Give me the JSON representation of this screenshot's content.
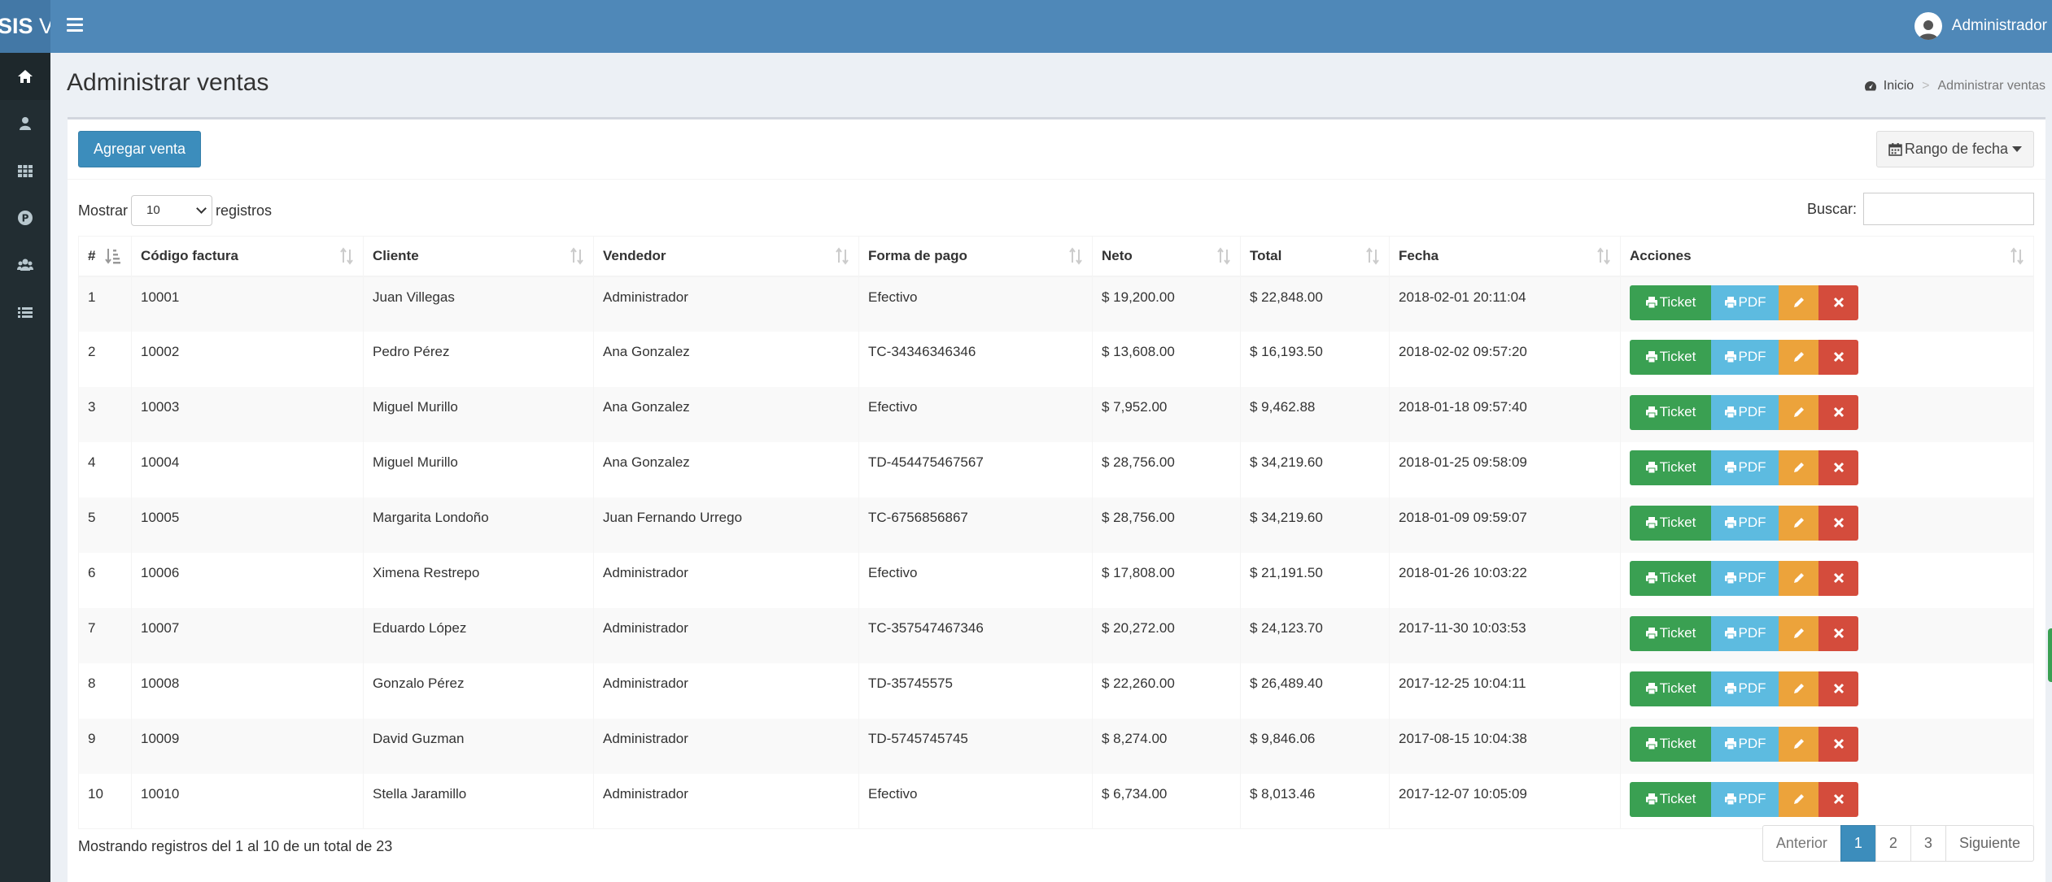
{
  "header": {
    "logo_bold": "SIS",
    "logo_light": " V",
    "user_name": "Administrador"
  },
  "sidebar": {
    "items": [
      {
        "icon": "home-icon",
        "active": true
      },
      {
        "icon": "user-icon",
        "active": false
      },
      {
        "icon": "grid-icon",
        "active": false
      },
      {
        "icon": "product-icon",
        "active": false
      },
      {
        "icon": "users-icon",
        "active": false
      },
      {
        "icon": "list-icon",
        "active": false
      }
    ]
  },
  "page": {
    "title": "Administrar ventas",
    "breadcrumb_home": "Inicio",
    "breadcrumb_sep": ">",
    "breadcrumb_current": "Administrar ventas"
  },
  "toolbar": {
    "add_label": "Agregar venta",
    "date_range_label": "Rango de fecha"
  },
  "table_controls": {
    "show_label": "Mostrar",
    "show_value": "10",
    "records_label": "registros",
    "search_label": "Buscar:",
    "search_value": ""
  },
  "table": {
    "columns": [
      "#",
      "Código factura",
      "Cliente",
      "Vendedor",
      "Forma de pago",
      "Neto",
      "Total",
      "Fecha",
      "Acciones"
    ],
    "rows": [
      [
        "1",
        "10001",
        "Juan Villegas",
        "Administrador",
        "Efectivo",
        "$ 19,200.00",
        "$ 22,848.00",
        "2018-02-01 20:11:04"
      ],
      [
        "2",
        "10002",
        "Pedro Pérez",
        "Ana Gonzalez",
        "TC-34346346346",
        "$ 13,608.00",
        "$ 16,193.50",
        "2018-02-02 09:57:20"
      ],
      [
        "3",
        "10003",
        "Miguel Murillo",
        "Ana Gonzalez",
        "Efectivo",
        "$ 7,952.00",
        "$ 9,462.88",
        "2018-01-18 09:57:40"
      ],
      [
        "4",
        "10004",
        "Miguel Murillo",
        "Ana Gonzalez",
        "TD-454475467567",
        "$ 28,756.00",
        "$ 34,219.60",
        "2018-01-25 09:58:09"
      ],
      [
        "5",
        "10005",
        "Margarita Londoño",
        "Juan Fernando Urrego",
        "TC-6756856867",
        "$ 28,756.00",
        "$ 34,219.60",
        "2018-01-09 09:59:07"
      ],
      [
        "6",
        "10006",
        "Ximena Restrepo",
        "Administrador",
        "Efectivo",
        "$ 17,808.00",
        "$ 21,191.50",
        "2018-01-26 10:03:22"
      ],
      [
        "7",
        "10007",
        "Eduardo López",
        "Administrador",
        "TC-357547467346",
        "$ 20,272.00",
        "$ 24,123.70",
        "2017-11-30 10:03:53"
      ],
      [
        "8",
        "10008",
        "Gonzalo Pérez",
        "Administrador",
        "TD-35745575",
        "$ 22,260.00",
        "$ 26,489.40",
        "2017-12-25 10:04:11"
      ],
      [
        "9",
        "10009",
        "David Guzman",
        "Administrador",
        "TD-5745745745",
        "$ 8,274.00",
        "$ 9,846.06",
        "2017-08-15 10:04:38"
      ],
      [
        "10",
        "10010",
        "Stella Jaramillo",
        "Administrador",
        "Efectivo",
        "$ 6,734.00",
        "$ 8,013.46",
        "2017-12-07 10:05:09"
      ]
    ],
    "action_labels": {
      "ticket": "Ticket",
      "pdf": "PDF"
    }
  },
  "footer": {
    "info": "Mostrando registros del 1 al 10 de un total de 23",
    "pagination": {
      "prev": "Anterior",
      "pages": [
        "1",
        "2",
        "3"
      ],
      "active_page": "1",
      "next": "Siguiente"
    }
  },
  "colors": {
    "header": "#4f88b8",
    "sidebar": "#222d32",
    "primary": "#3c8dbc",
    "ticket": "#3aa052",
    "pdf": "#5dbbe0",
    "edit": "#eca33b",
    "delete": "#d44c3c"
  }
}
